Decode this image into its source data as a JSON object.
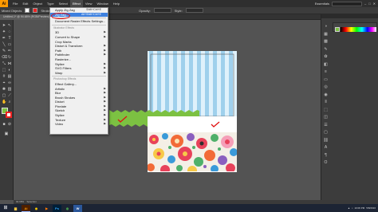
{
  "menubar": {
    "logo": "Ai",
    "items": [
      "File",
      "Edit",
      "Object",
      "Type",
      "Select",
      "Effect",
      "View",
      "Window",
      "Help"
    ],
    "active_index": 5,
    "workspace": "Essentials"
  },
  "controlbar": {
    "selection_label": "Mixed Objects",
    "stroke_label": "Stroke:",
    "opacity_label": "Opacity:",
    "style_label": "Style:"
  },
  "document_tab": "Untitled-1* @ 94.68% (RGB/Preview)",
  "effect_menu": {
    "top_items": [
      {
        "label": "Apply Zig Zag",
        "shortcut": "Shift+Ctrl+E",
        "disabled": false,
        "highlight": false,
        "submenu": false
      },
      {
        "label": "Zig Zag...",
        "shortcut": "Alt+Shift+Ctrl+E",
        "disabled": false,
        "highlight": true,
        "submenu": false
      }
    ],
    "document_raster": "Document Raster Effects Settings...",
    "illustrator_section": "Illustrator Effects",
    "illustrator_items": [
      "3D",
      "Convert to Shape",
      "Crop Marks",
      "Distort & Transform",
      "Path",
      "Pathfinder",
      "Rasterize...",
      "Stylize",
      "SVG Filters",
      "Warp"
    ],
    "photoshop_section": "Photoshop Effects",
    "photoshop_items": [
      "Effect Gallery...",
      "Artistic",
      "Blur",
      "Brush Strokes",
      "Distort",
      "Pixelate",
      "Sketch",
      "Stylize",
      "Texture",
      "Video"
    ],
    "submenu_flags_illustrator": [
      true,
      true,
      false,
      true,
      true,
      true,
      false,
      true,
      true,
      true
    ],
    "submenu_flags_photoshop": [
      false,
      true,
      true,
      true,
      true,
      true,
      true,
      true,
      true,
      true
    ]
  },
  "status": {
    "zoom": "94.68%",
    "tool": "Selection"
  },
  "taskbar": {
    "apps": [
      "Ai",
      "Ps",
      "W"
    ],
    "time": "10:06 PM",
    "date": "5/8/2016"
  },
  "colors": {
    "stripe_blue": "#9fd0ec",
    "stripe_light": "#dff1fb",
    "zigzag_green": "#7cc142",
    "check_red": "#e01010",
    "menu_highlight": "#3d80df"
  }
}
